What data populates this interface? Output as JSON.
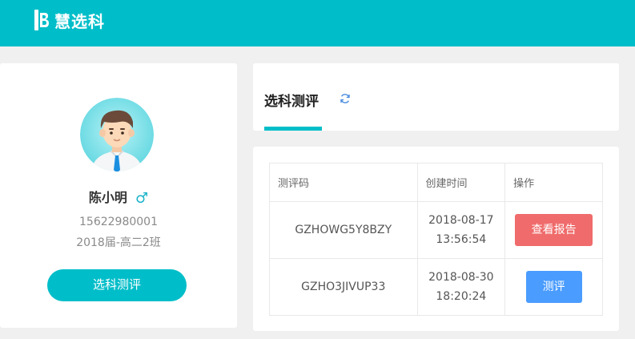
{
  "app": {
    "name": "慧选科"
  },
  "profile": {
    "name": "陈小明",
    "gender_icon": "♂",
    "phone": "15622980001",
    "class_info": "2018届-高二2班",
    "action_label": "选科测评"
  },
  "tabs": {
    "active_label": "选科测评"
  },
  "table": {
    "headers": [
      "测评码",
      "创建时间",
      "操作"
    ],
    "rows": [
      {
        "code": "GZHOWG5Y8BZY",
        "date": "2018-08-17",
        "time": "13:56:54",
        "action": "查看报告"
      },
      {
        "code": "GZHO3JIVUP33",
        "date": "2018-08-30",
        "time": "18:20:24",
        "action": "测评"
      }
    ]
  },
  "colors": {
    "brand": "#00bec9",
    "report_button": "#f06b6b",
    "evaluate_button": "#4a9cff"
  }
}
